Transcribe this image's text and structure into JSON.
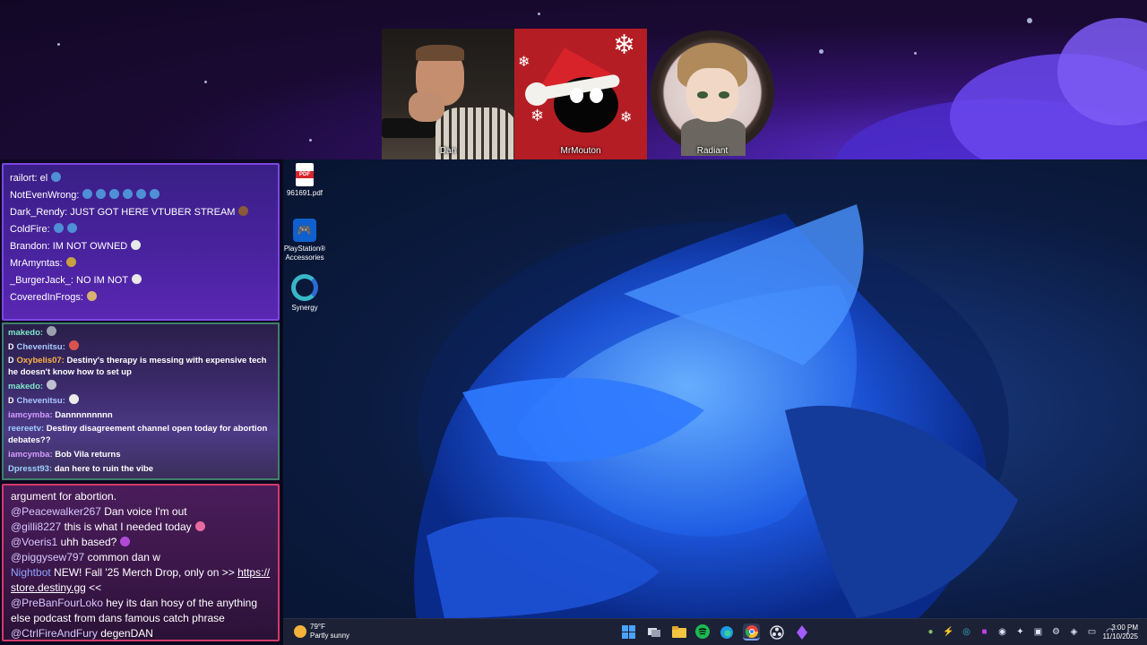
{
  "cams": {
    "dan_name": "Dan",
    "dan_tag": "Radiant",
    "mouton_name": "MrMouton",
    "radiant_name": "Radiant"
  },
  "chat_top": [
    {
      "user": "railort:",
      "text": "el"
    },
    {
      "user": "NotEvenWrong:",
      "text": ""
    },
    {
      "user": "Dark_Rendy:",
      "text": "JUST GOT HERE  VTUBER STREAM"
    },
    {
      "user": "ColdFire:",
      "text": ""
    },
    {
      "user": "Brandon:",
      "text": "IM NOT OWNED"
    },
    {
      "user": "MrAmyntas:",
      "text": ""
    },
    {
      "user": "_BurgerJack_:",
      "text": "NO IM NOT"
    },
    {
      "user": "CoveredInFrogs:",
      "text": ""
    }
  ],
  "chat_mid": [
    {
      "badge": "",
      "user": "makedo:",
      "text": "",
      "color": "#7de8c9"
    },
    {
      "badge": "D",
      "user": "Chevenitsu:",
      "text": "",
      "color": "#a8c8ff"
    },
    {
      "badge": "D",
      "user": "Oxybelis07:",
      "text": "Destiny's therapy is messing with expensive tech he doesn't know how to set up",
      "color": "#ffb347"
    },
    {
      "badge": "",
      "user": "makedo:",
      "text": "",
      "color": "#7de8c9"
    },
    {
      "badge": "D",
      "user": "Chevenitsu:",
      "text": "",
      "color": "#a8c8ff"
    },
    {
      "badge": "",
      "user": "iamcymba:",
      "text": "Dannnnnnnnn",
      "color": "#d69cff"
    },
    {
      "badge": "",
      "user": "reereetv:",
      "text": "Destiny disagreement channel open today for abortion debates??",
      "color": "#9fd0ff"
    },
    {
      "badge": "",
      "user": "iamcymba:",
      "text": "Bob Vila returns",
      "color": "#d69cff"
    },
    {
      "badge": "",
      "user": "Dpresst93:",
      "text": "dan here to ruin the vibe",
      "color": "#9fd0ff"
    }
  ],
  "chat_bottom": {
    "line0": "argument for abortion.",
    "rows": [
      {
        "user": "@Peacewalker267",
        "text": "Dan voice I'm out"
      },
      {
        "user": "@gilli8227",
        "text": "this is what I needed today"
      },
      {
        "user": "@Voeris1",
        "text": "uhh based?"
      },
      {
        "user": "@piggysew797",
        "text": "common dan w"
      }
    ],
    "nightbot_user": "Nightbot",
    "nightbot_text": "NEW! Fall '25 Merch Drop, only on >> ",
    "nightbot_link": "https://store.destiny.gg",
    "nightbot_tail": " <<",
    "row_pre": {
      "user": "@PreBanFourLoko",
      "text": "hey its dan hosy of the anything else podcast from dans famous catch phrase"
    },
    "row_ctrl": {
      "user": "@CtrlFireAndFury",
      "text": "degenDAN"
    }
  },
  "desktop": {
    "icons": [
      {
        "label": "961691.pdf",
        "glyph": "PDF"
      },
      {
        "label": "PlayStation® Accessories",
        "glyph": "🎮"
      },
      {
        "label": "Synergy",
        "glyph": ""
      }
    ]
  },
  "taskbar": {
    "temp": "79°F",
    "weather": "Partly sunny",
    "time": "3:00 PM",
    "date": "11/10/2025"
  },
  "colors": {
    "accent_purple": "#7b47e0",
    "nightbot": "#8ea4ff",
    "taskbar": "#1c2136"
  }
}
